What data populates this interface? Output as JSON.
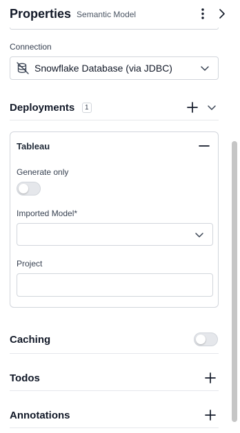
{
  "header": {
    "title": "Properties",
    "subtitle": "Semantic Model"
  },
  "connection": {
    "label": "Connection",
    "value": "Snowflake Database (via JDBC)"
  },
  "deployments": {
    "title": "Deployments",
    "count": "1",
    "card": {
      "title": "Tableau",
      "generate_only_label": "Generate only",
      "generate_only_enabled": false,
      "imported_model_label": "Imported Model*",
      "imported_model_value": "",
      "project_label": "Project",
      "project_value": ""
    }
  },
  "caching": {
    "title": "Caching",
    "enabled": false
  },
  "todos": {
    "title": "Todos"
  },
  "annotations": {
    "title": "Annotations"
  },
  "icons": {
    "header_menu": "more-vertical-icon",
    "header_collapse": "chevron-right-icon",
    "connection": "database-off-icon",
    "dropdown": "chevron-down-icon",
    "add": "plus-icon",
    "collapse_card": "minus-icon"
  }
}
